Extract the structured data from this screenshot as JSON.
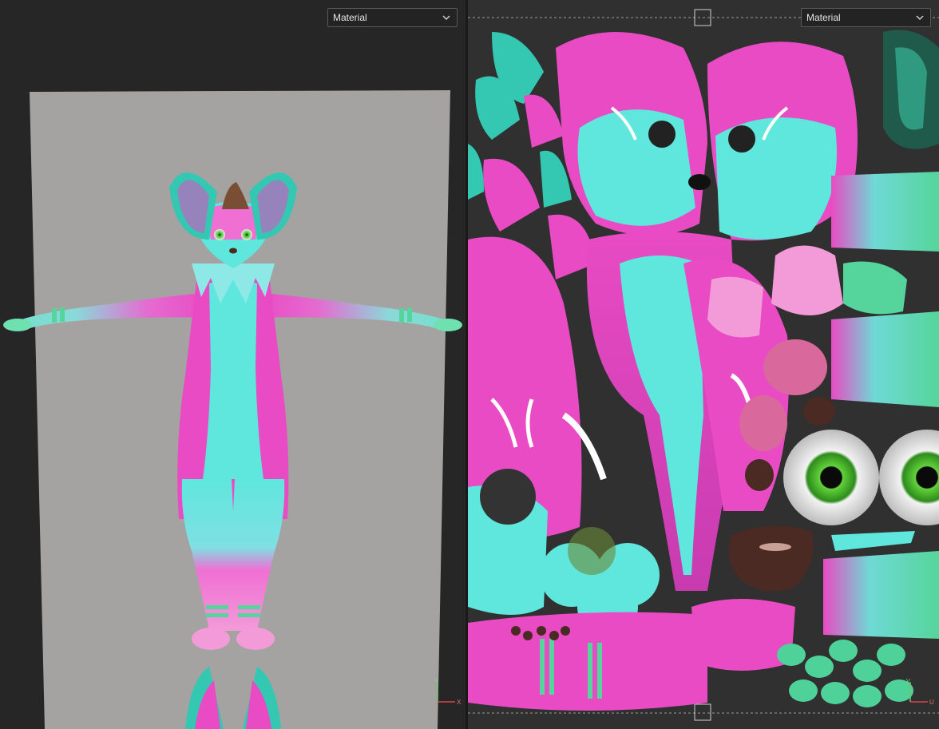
{
  "viewport3d": {
    "shading_mode": "Material",
    "axis_labels": {
      "up": "Y",
      "right": "X"
    }
  },
  "uv_editor": {
    "shading_mode": "Material",
    "axis_labels": {
      "up": "V",
      "right": "U"
    }
  },
  "colors": {
    "fur_pink": "#e84bc3",
    "fur_cyan": "#5fe6dd",
    "stripe_green": "#55d59b",
    "eye_green": "#3fbf2a",
    "nose_brown": "#4a2a22",
    "background_plane": "#a4a3a2",
    "uv_background": "#303030"
  }
}
